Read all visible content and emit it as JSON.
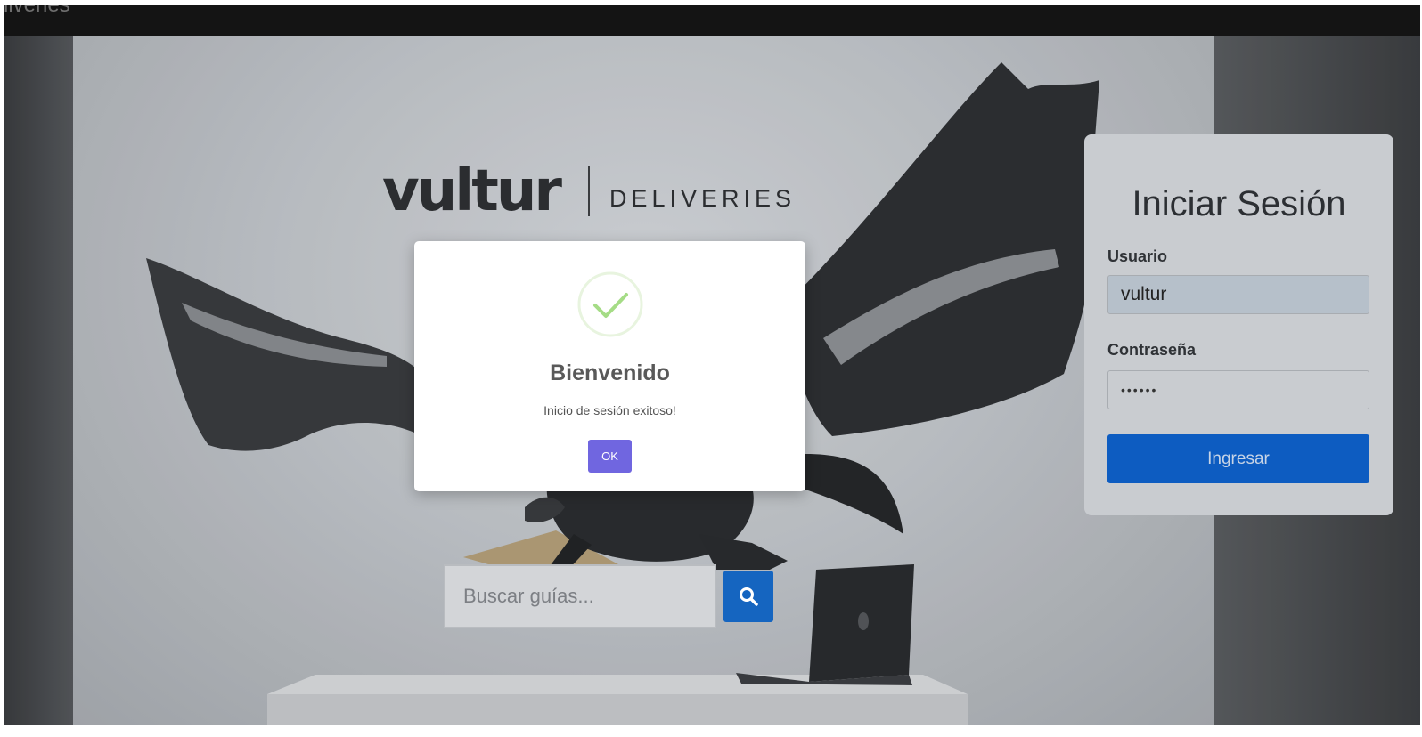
{
  "app": {
    "partial_title": "liveries"
  },
  "brand": {
    "name": "vultur",
    "tagline": "DELIVERIES"
  },
  "search": {
    "placeholder": "Buscar guías..."
  },
  "login": {
    "title": "Iniciar Sesión",
    "user_label": "Usuario",
    "user_value": "vultur",
    "password_label": "Contraseña",
    "password_value": "••••••",
    "submit_label": "Ingresar"
  },
  "modal": {
    "title": "Bienvenido",
    "message": "Inicio de sesión exitoso!",
    "ok_label": "OK",
    "icon": "success-check-icon"
  },
  "colors": {
    "primary_blue": "#0d5cc1",
    "ok_button": "#7066e0",
    "success_green": "#a5dc86",
    "topbar": "#141414"
  }
}
